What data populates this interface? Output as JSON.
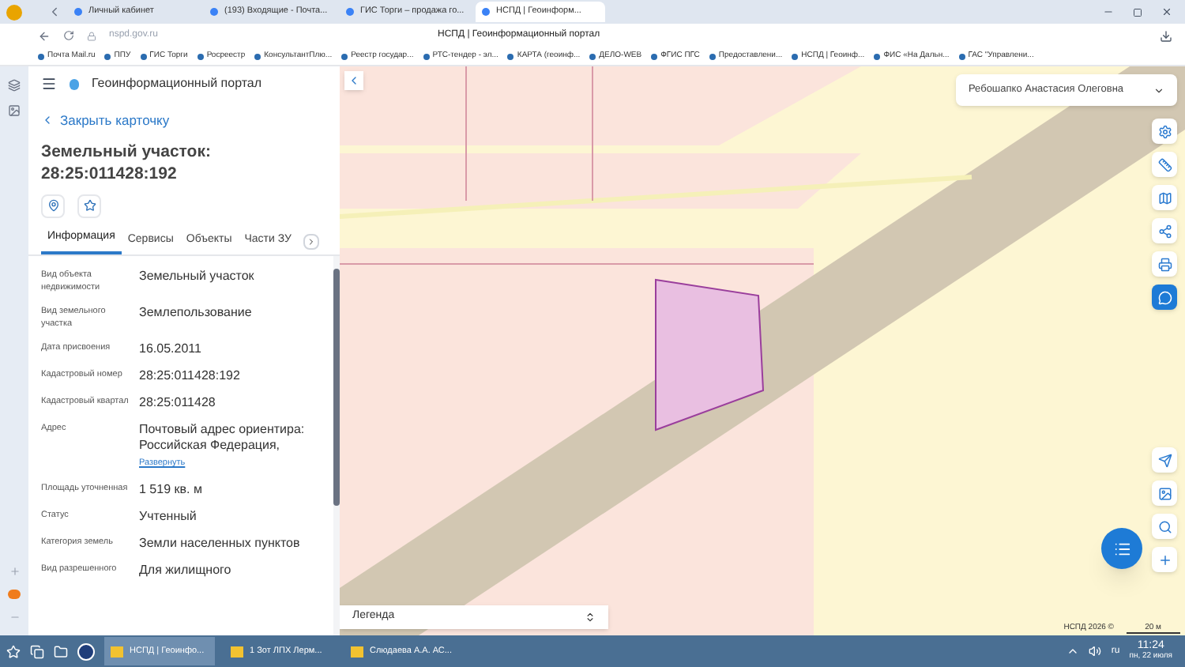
{
  "browser": {
    "tabs": [
      {
        "label": "Личный кабинет",
        "selected": false
      },
      {
        "label": "(193) Входящие - Почта...",
        "selected": false
      },
      {
        "label": "ГИС Торги – продажа го...",
        "selected": false
      },
      {
        "label": "НСПД | Геоинформ...",
        "selected": true
      }
    ],
    "address": "nspd.gov.ru",
    "page_title": "НСПД | Геоинформационный портал",
    "bookmarks": [
      "Почта Mail.ru",
      "ППУ",
      "ГИС Торги",
      "Росреестр",
      "КонсультантПлю...",
      "Реестр государ...",
      "РТС-тендер - эл...",
      "КАРТА (геоинф...",
      "ДЕЛО-WEB",
      "ФГИС ПГС",
      "Предоставлени...",
      "НСПД | Геоинф...",
      "ФИС «На Дальн...",
      "ГАС \"Управлени..."
    ]
  },
  "portal": {
    "title": "Геоинформационный портал",
    "close_link": "Закрыть карточку",
    "card_title": "Земельный участок:",
    "card_number": "28:25:011428:192",
    "tabs": [
      {
        "label": "Информация",
        "selected": true
      },
      {
        "label": "Сервисы",
        "selected": false
      },
      {
        "label": "Объекты",
        "selected": false
      },
      {
        "label": "Части ЗУ",
        "selected": false
      }
    ],
    "fields": [
      {
        "label": "Вид объекта недвижимости",
        "value": "Земельный участок"
      },
      {
        "label": "Вид земельного участка",
        "value": "Землепользование"
      },
      {
        "label": "Дата присвоения",
        "value": "16.05.2011"
      },
      {
        "label": "Кадастровый номер",
        "value": "28:25:011428:192"
      },
      {
        "label": "Кадастровый квартал",
        "value": "28:25:011428"
      },
      {
        "label": "Адрес",
        "value": "Почтовый адрес ориентира: Российская Федерация,",
        "link": "Развернуть"
      },
      {
        "label": "Площадь уточненная",
        "value": "1 519 кв. м"
      },
      {
        "label": "Статус",
        "value": "Учтенный"
      },
      {
        "label": "Категория земель",
        "value": "Земли населенных пунктов"
      },
      {
        "label": "Вид разрешенного",
        "value": "Для жилищного"
      }
    ]
  },
  "map": {
    "user": "Ребошапко Анастасия Олеговна",
    "legend": "Легенда",
    "copyright": "НСПД 2026 ©",
    "scale": "20 м"
  },
  "taskbar": {
    "windows": [
      {
        "label": "НСПД | Геоинфо...",
        "selected": true
      },
      {
        "label": "1 Зот ЛПХ Лерм...",
        "selected": false
      },
      {
        "label": "Слюдаева А.А. АС...",
        "selected": false
      }
    ],
    "language": "ru",
    "time": "11:24",
    "date": "пн, 22 июля"
  }
}
